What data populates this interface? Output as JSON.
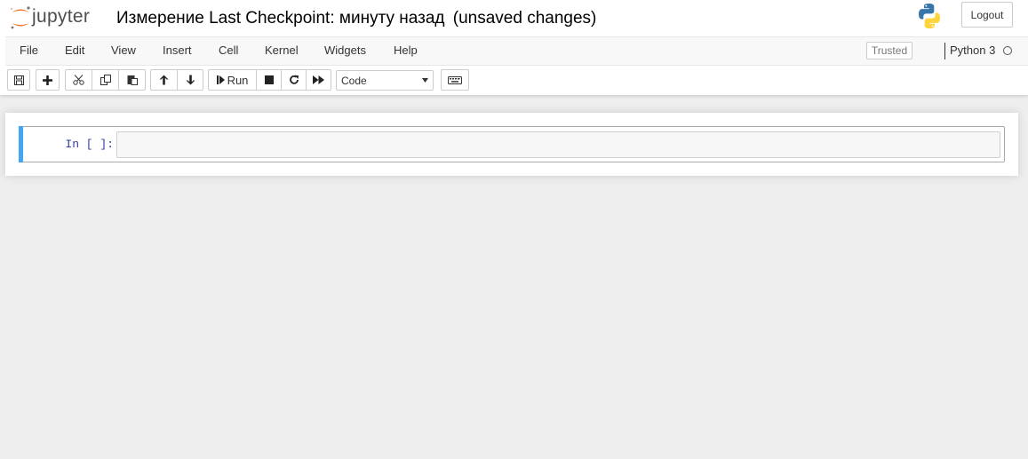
{
  "header": {
    "logo_text": "jupyter",
    "notebook_name": "Измерение",
    "checkpoint_label": "Last Checkpoint:",
    "checkpoint_time": "минуту назад",
    "autosave_status": "(unsaved changes)",
    "logout_label": "Logout",
    "kernel_logo_icon": "python-logo-icon"
  },
  "menubar": {
    "items": [
      {
        "label": "File"
      },
      {
        "label": "Edit"
      },
      {
        "label": "View"
      },
      {
        "label": "Insert"
      },
      {
        "label": "Cell"
      },
      {
        "label": "Kernel"
      },
      {
        "label": "Widgets"
      },
      {
        "label": "Help"
      }
    ],
    "trusted_label": "Trusted",
    "kernel_name": "Python 3",
    "kernel_status": "idle"
  },
  "toolbar": {
    "buttons": [
      {
        "icon": "save-icon"
      },
      {
        "icon": "plus-icon"
      },
      {
        "icon": "cut-icon"
      },
      {
        "icon": "copy-icon"
      },
      {
        "icon": "paste-icon"
      },
      {
        "icon": "arrow-up-icon"
      },
      {
        "icon": "arrow-down-icon"
      },
      {
        "icon": "step-forward-icon"
      },
      {
        "icon": "stop-icon"
      },
      {
        "icon": "restart-icon"
      },
      {
        "icon": "fast-forward-icon"
      },
      {
        "icon": "keyboard-icon"
      }
    ],
    "run_label": "Run",
    "cell_type": "Code"
  },
  "cell": {
    "prompt": "In [ ]:",
    "source": ""
  },
  "colors": {
    "accent_blue": "#42a5f5",
    "prompt_blue": "#303f9f",
    "logo_orange": "#f37726",
    "page_bg": "#eeeeee"
  }
}
